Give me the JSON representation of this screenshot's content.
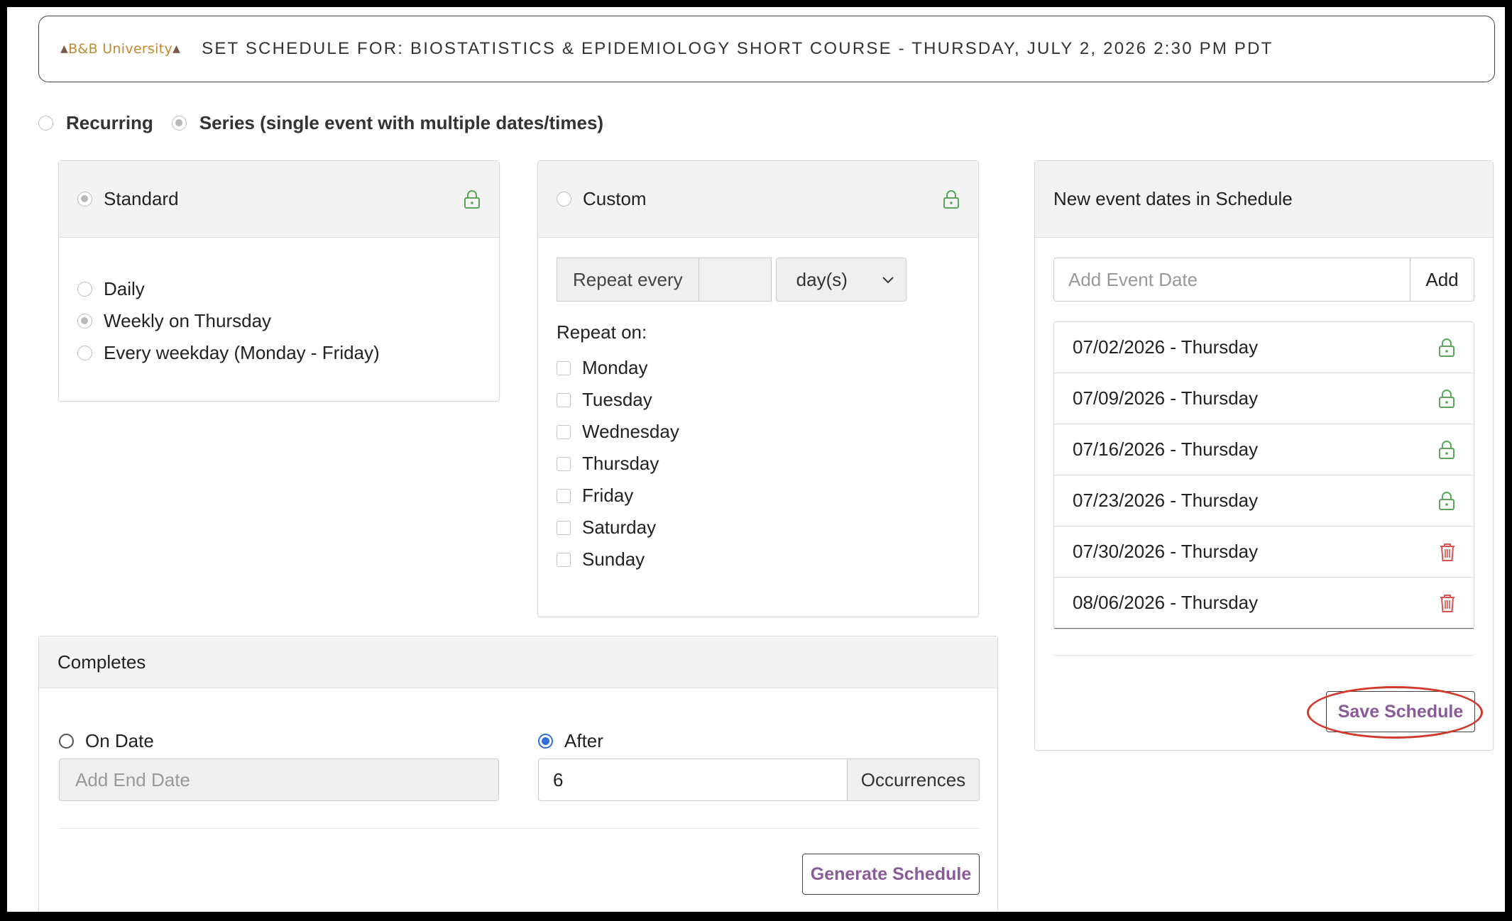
{
  "header": {
    "logo_text": "B&B University",
    "title": "SET SCHEDULE FOR: BIOSTATISTICS & EPIDEMIOLOGY SHORT COURSE - THURSDAY, JULY 2, 2026 2:30 PM PDT"
  },
  "schedule_type": {
    "options": [
      {
        "label": "Recurring",
        "selected": false
      },
      {
        "label": "Series (single event with multiple dates/times)",
        "selected": true
      }
    ]
  },
  "standard": {
    "title": "Standard",
    "options": [
      {
        "label": "Daily",
        "selected": false
      },
      {
        "label": "Weekly on Thursday",
        "selected": true
      },
      {
        "label": "Every weekday (Monday - Friday)",
        "selected": false
      }
    ]
  },
  "custom": {
    "title": "Custom",
    "repeat_every_label": "Repeat every",
    "repeat_every_value": "",
    "unit_selected": "day(s)",
    "repeat_on_label": "Repeat on:",
    "days": [
      "Monday",
      "Tuesday",
      "Wednesday",
      "Thursday",
      "Friday",
      "Saturday",
      "Sunday"
    ]
  },
  "completes": {
    "title": "Completes",
    "on_date_label": "On Date",
    "end_date_placeholder": "Add End Date",
    "after_label": "After",
    "after_value": "6",
    "occurrences_label": "Occurrences",
    "generate_button": "Generate Schedule"
  },
  "event_dates": {
    "title": "New event dates in Schedule",
    "add_placeholder": "Add Event Date",
    "add_button": "Add",
    "items": [
      {
        "label": "07/02/2026 - Thursday",
        "icon": "lock-icon"
      },
      {
        "label": "07/09/2026 - Thursday",
        "icon": "lock-icon"
      },
      {
        "label": "07/16/2026 - Thursday",
        "icon": "lock-icon"
      },
      {
        "label": "07/23/2026 - Thursday",
        "icon": "lock-icon"
      },
      {
        "label": "07/30/2026 - Thursday",
        "icon": "trash-icon"
      },
      {
        "label": "08/06/2026 - Thursday",
        "icon": "trash-icon"
      }
    ],
    "save_button": "Save Schedule"
  },
  "colors": {
    "lock": "#5aa55a",
    "trash": "#d9534f",
    "accent_purple": "#8a5b97",
    "highlight_red": "#d03a2c",
    "radio_blue": "#2f6fde"
  }
}
